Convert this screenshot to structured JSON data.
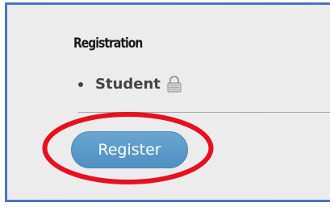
{
  "registration": {
    "title": "Registration",
    "items": [
      {
        "label": "Student",
        "icon": "lock-icon"
      }
    ],
    "register_button_label": "Register"
  },
  "colors": {
    "frame_border": "#4a74c4",
    "button": "#5b9ac8",
    "highlight_ring": "#e8101e"
  }
}
